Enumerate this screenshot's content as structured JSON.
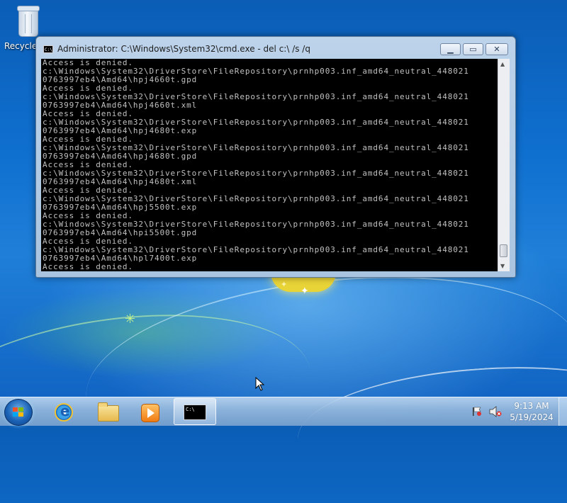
{
  "desktop": {
    "recycle_bin_label": "Recycle Bin"
  },
  "cmd_window": {
    "title": "Administrator: C:\\Windows\\System32\\cmd.exe - del  c:\\ /s /q",
    "console_lines": [
      "Access is denied.",
      "c:\\Windows\\System32\\DriverStore\\FileRepository\\prnhp003.inf_amd64_neutral_448021",
      "0763997eb4\\Amd64\\hpj4660t.gpd",
      "Access is denied.",
      "c:\\Windows\\System32\\DriverStore\\FileRepository\\prnhp003.inf_amd64_neutral_448021",
      "0763997eb4\\Amd64\\hpj4660t.xml",
      "Access is denied.",
      "c:\\Windows\\System32\\DriverStore\\FileRepository\\prnhp003.inf_amd64_neutral_448021",
      "0763997eb4\\Amd64\\hpj4680t.exp",
      "Access is denied.",
      "c:\\Windows\\System32\\DriverStore\\FileRepository\\prnhp003.inf_amd64_neutral_448021",
      "0763997eb4\\Amd64\\hpj4680t.gpd",
      "Access is denied.",
      "c:\\Windows\\System32\\DriverStore\\FileRepository\\prnhp003.inf_amd64_neutral_448021",
      "0763997eb4\\Amd64\\hpj4680t.xml",
      "Access is denied.",
      "c:\\Windows\\System32\\DriverStore\\FileRepository\\prnhp003.inf_amd64_neutral_448021",
      "0763997eb4\\Amd64\\hpj5500t.exp",
      "Access is denied.",
      "c:\\Windows\\System32\\DriverStore\\FileRepository\\prnhp003.inf_amd64_neutral_448021",
      "0763997eb4\\Amd64\\hpi5500t.gpd",
      "Access is denied.",
      "c:\\Windows\\System32\\DriverStore\\FileRepository\\prnhp003.inf_amd64_neutral_448021",
      "0763997eb4\\Amd64\\hpl7400t.exp",
      "Access is denied."
    ],
    "cmd_icon_text": "C:\\",
    "colors": {
      "console_bg": "#000000",
      "console_fg": "#c0c0c0"
    },
    "scroll_position_fraction": 0.95
  },
  "taskbar": {
    "pinned": [
      "internet-explorer-icon",
      "windows-explorer-icon",
      "media-player-icon",
      "command-prompt-icon"
    ],
    "active_item": "command-prompt",
    "clock_time": "9:13 AM",
    "clock_date": "5/19/2024"
  }
}
